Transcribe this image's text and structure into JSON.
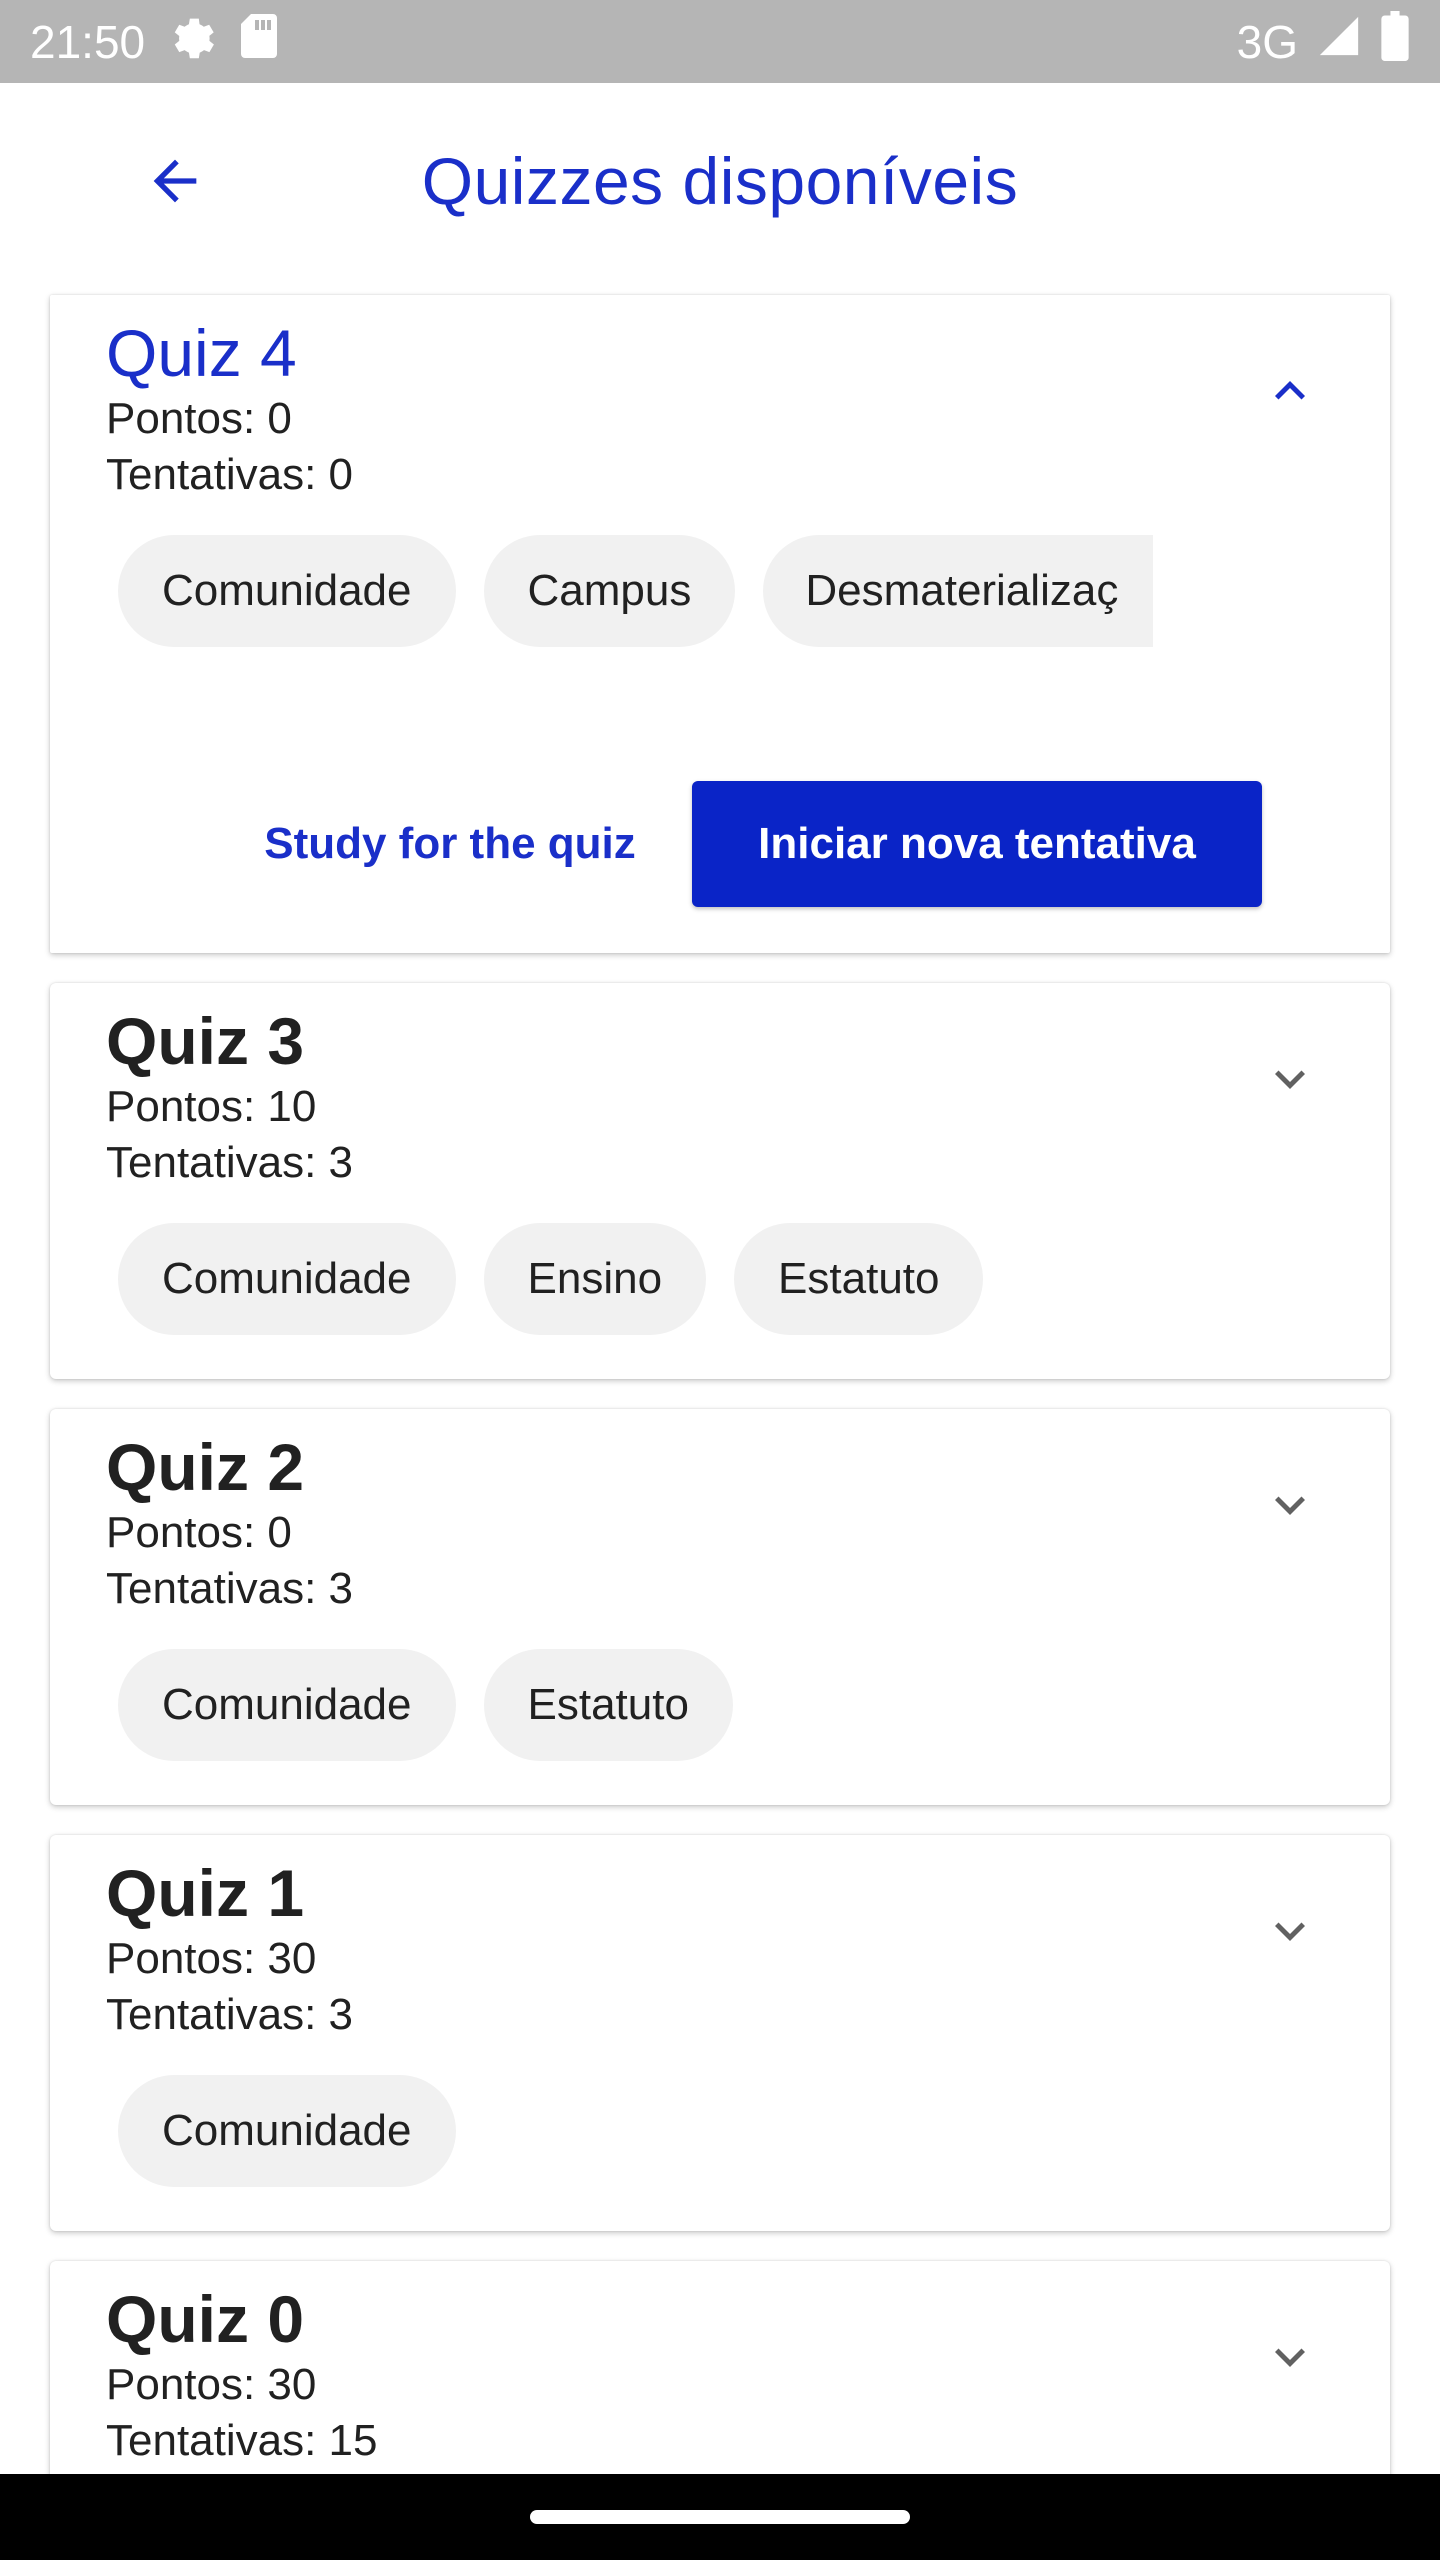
{
  "status_bar": {
    "time": "21:50",
    "network": "3G",
    "icons": [
      "settings-gear-icon",
      "sd-card-icon",
      "signal-icon",
      "battery-icon"
    ]
  },
  "app_bar": {
    "title": "Quizzes disponíveis",
    "back_icon": "arrow-left-icon"
  },
  "colors": {
    "accent": "#1a2fc9",
    "primary_button": "#0a24c7",
    "chip_bg": "#f1f1f1",
    "status_bar_bg": "#b5b5b5"
  },
  "quizzes": [
    {
      "title": "Quiz 4",
      "points": "Pontos: 0",
      "attempts": "Tentativas: 0",
      "expanded": true,
      "tags": [
        "Comunidade",
        "Campus",
        "Desmaterializaç"
      ],
      "study_label": "Study for the quiz",
      "start_label": "Iniciar nova tentativa"
    },
    {
      "title": "Quiz 3",
      "points": "Pontos: 10",
      "attempts": "Tentativas: 3",
      "expanded": false,
      "tags": [
        "Comunidade",
        "Ensino",
        "Estatuto"
      ]
    },
    {
      "title": "Quiz 2",
      "points": "Pontos: 0",
      "attempts": "Tentativas: 3",
      "expanded": false,
      "tags": [
        "Comunidade",
        "Estatuto"
      ]
    },
    {
      "title": "Quiz 1",
      "points": "Pontos: 30",
      "attempts": "Tentativas: 3",
      "expanded": false,
      "tags": [
        "Comunidade"
      ]
    },
    {
      "title": "Quiz 0",
      "points": "Pontos: 30",
      "attempts": "Tentativas: 15",
      "expanded": false,
      "tags": []
    }
  ]
}
